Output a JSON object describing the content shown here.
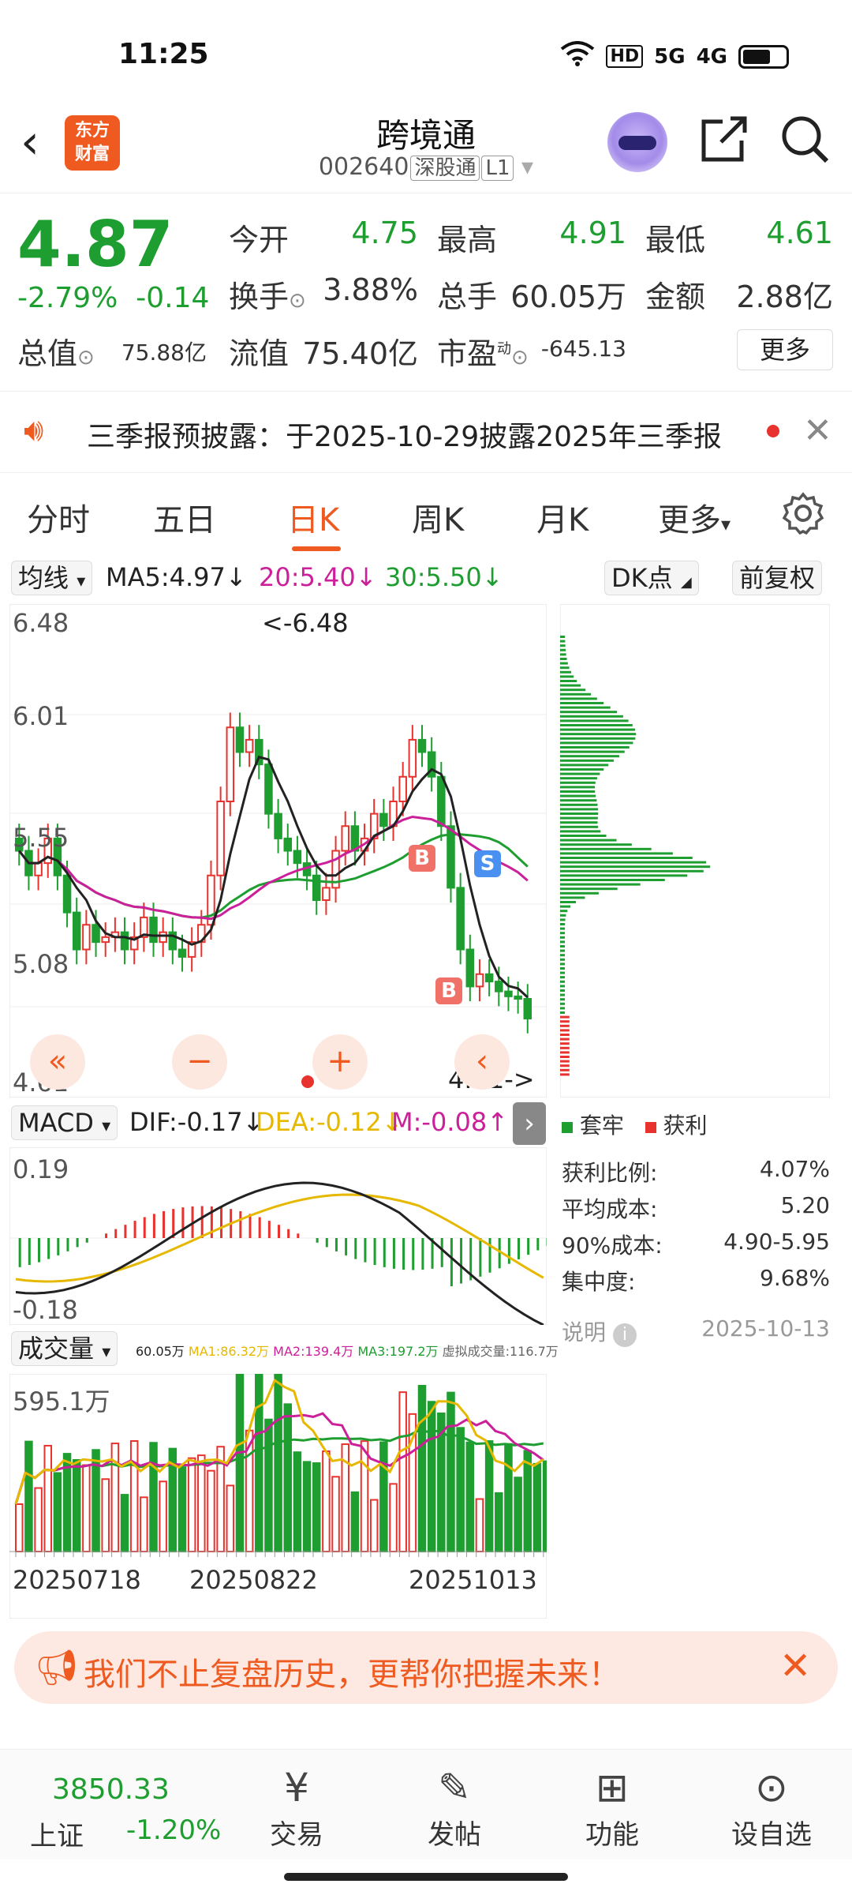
{
  "status": {
    "time": "11:25",
    "hd": "HD",
    "net1": "5G",
    "net2": "4G"
  },
  "header": {
    "logo_line1": "东方",
    "logo_line2": "财富",
    "title": "跨境通",
    "code": "002640",
    "market": "深股通",
    "level": "L1"
  },
  "quote": {
    "price": "4.87",
    "change_pct": "-2.79%",
    "change": "-0.14",
    "open_label": "今开",
    "open": "4.75",
    "high_label": "最高",
    "high": "4.91",
    "low_label": "最低",
    "low": "4.61",
    "turnover_label": "换手",
    "turnover": "3.88%",
    "volume_label": "总手",
    "volume": "60.05万",
    "amount_label": "金额",
    "amount": "2.88亿",
    "mktcap_label": "总值",
    "mktcap": "75.88亿",
    "float_label": "流值",
    "float": "75.40亿",
    "pe_label": "市盈",
    "pe_sup": "动",
    "pe": "-645.13",
    "more": "更多"
  },
  "notice": {
    "text": "三季报预披露：于2025-10-29披露2025年三季报"
  },
  "tabs": [
    "分时",
    "五日",
    "日K",
    "周K",
    "月K",
    "更多"
  ],
  "ma_row": {
    "selector": "均线",
    "ma5": "MA5:4.97",
    "ma20": "20:5.40",
    "ma30": "30:5.50",
    "dk": "DK点",
    "fq": "前复权"
  },
  "kchart": {
    "y_labels": [
      "6.48",
      "6.01",
      "5.55",
      "5.08",
      "4.61"
    ],
    "max_note": "<-6.48",
    "min_note": "4.61->",
    "buy_mark": "B",
    "sell_mark": "S"
  },
  "legend": {
    "trapped": "套牢",
    "profit": "获利",
    "trapped_color": "#1e9e30",
    "profit_color": "#e8322d"
  },
  "chip_stats": [
    {
      "label": "获利比例:",
      "value": "4.07%"
    },
    {
      "label": "平均成本:",
      "value": "5.20"
    },
    {
      "label": "90%成本:",
      "value": "4.90-5.95"
    },
    {
      "label": "集中度:",
      "value": "9.68%"
    }
  ],
  "chip_note": {
    "label": "说明",
    "date": "2025-10-13"
  },
  "macd": {
    "selector": "MACD",
    "dif": "DIF:-0.17",
    "dea": "DEA:-0.12",
    "m": "M:-0.08",
    "top": "0.19",
    "bottom": "-0.18"
  },
  "volume": {
    "selector": "成交量",
    "v": "60.05万",
    "ma1": "MA1:86.32万",
    "ma2": "MA2:139.4万",
    "ma3": "MA3:197.2万",
    "virt": "虚拟成交量:116.7万",
    "top": "595.1万"
  },
  "dates": [
    "20250718",
    "20250822",
    "20251013"
  ],
  "banner": {
    "text": "我们不止复盘历史，更帮你把握未来！"
  },
  "bottom": {
    "index_value": "3850.33",
    "index_name": "上证",
    "index_change": "-1.20%",
    "items": [
      "交易",
      "发帖",
      "功能",
      "设自选"
    ]
  },
  "colors": {
    "up": "#e8322d",
    "down": "#1e9e30",
    "accent": "#ee5a20",
    "ma5": "#222222",
    "ma20": "#cc1f9a",
    "ma30": "#1e9e30"
  }
}
